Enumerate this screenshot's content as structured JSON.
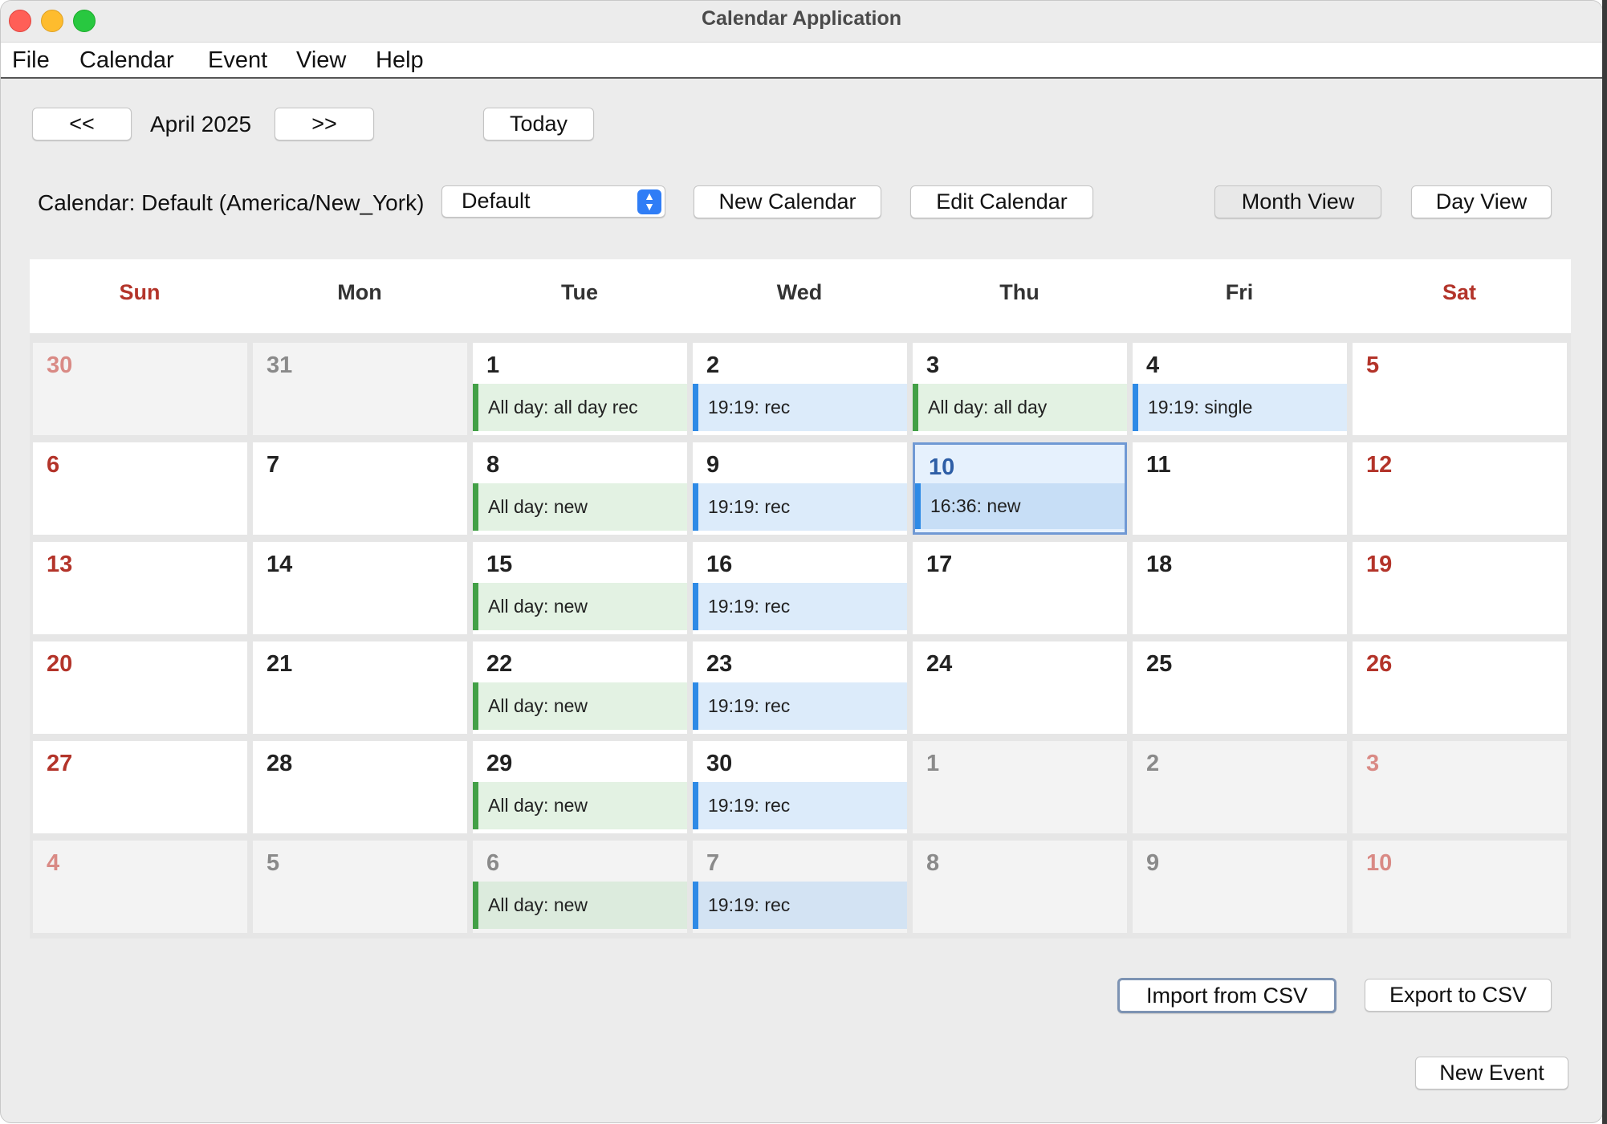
{
  "window": {
    "title": "Calendar Application"
  },
  "menu": [
    "File",
    "Calendar",
    "Event",
    "View",
    "Help"
  ],
  "nav": {
    "prev": "<<",
    "month_label": "April 2025",
    "next": ">>",
    "today": "Today"
  },
  "calendar_bar": {
    "label": "Calendar: Default (America/New_York)",
    "selected": "Default",
    "new_calendar": "New Calendar",
    "edit_calendar": "Edit Calendar",
    "month_view": "Month View",
    "day_view": "Day View"
  },
  "weekdays": [
    "Sun",
    "Mon",
    "Tue",
    "Wed",
    "Thu",
    "Fri",
    "Sat"
  ],
  "weeks": [
    [
      {
        "day": "30",
        "other": true
      },
      {
        "day": "31",
        "other": true
      },
      {
        "day": "1",
        "event": "All day: all day rec",
        "kind": "allday"
      },
      {
        "day": "2",
        "event": "19:19: rec",
        "kind": "timed"
      },
      {
        "day": "3",
        "event": "All day: all day",
        "kind": "allday"
      },
      {
        "day": "4",
        "event": "19:19: single",
        "kind": "timed"
      },
      {
        "day": "5"
      }
    ],
    [
      {
        "day": "6"
      },
      {
        "day": "7"
      },
      {
        "day": "8",
        "event": "All day: new",
        "kind": "allday"
      },
      {
        "day": "9",
        "event": "19:19: rec",
        "kind": "timed"
      },
      {
        "day": "10",
        "event": "16:36: new",
        "kind": "timed",
        "today": true
      },
      {
        "day": "11"
      },
      {
        "day": "12"
      }
    ],
    [
      {
        "day": "13"
      },
      {
        "day": "14"
      },
      {
        "day": "15",
        "event": "All day: new",
        "kind": "allday"
      },
      {
        "day": "16",
        "event": "19:19: rec",
        "kind": "timed"
      },
      {
        "day": "17"
      },
      {
        "day": "18"
      },
      {
        "day": "19"
      }
    ],
    [
      {
        "day": "20"
      },
      {
        "day": "21"
      },
      {
        "day": "22",
        "event": "All day: new",
        "kind": "allday"
      },
      {
        "day": "23",
        "event": "19:19: rec",
        "kind": "timed"
      },
      {
        "day": "24"
      },
      {
        "day": "25"
      },
      {
        "day": "26"
      }
    ],
    [
      {
        "day": "27"
      },
      {
        "day": "28"
      },
      {
        "day": "29",
        "event": "All day: new",
        "kind": "allday"
      },
      {
        "day": "30",
        "event": "19:19: rec",
        "kind": "timed"
      },
      {
        "day": "1",
        "other": true
      },
      {
        "day": "2",
        "other": true
      },
      {
        "day": "3",
        "other": true
      }
    ],
    [
      {
        "day": "4",
        "other": true
      },
      {
        "day": "5",
        "other": true
      },
      {
        "day": "6",
        "other": true,
        "event": "All day: new",
        "kind": "allday"
      },
      {
        "day": "7",
        "other": true,
        "event": "19:19: rec",
        "kind": "timed"
      },
      {
        "day": "8",
        "other": true
      },
      {
        "day": "9",
        "other": true
      },
      {
        "day": "10",
        "other": true
      }
    ]
  ],
  "footer": {
    "import": "Import from CSV",
    "export": "Export to CSV",
    "new_event": "New Event"
  },
  "colors": {
    "all_day_bar": "#43a047",
    "timed_bar": "#2e8ae6",
    "weekend_text": "#b3342a",
    "today_border": "#7099d4"
  }
}
